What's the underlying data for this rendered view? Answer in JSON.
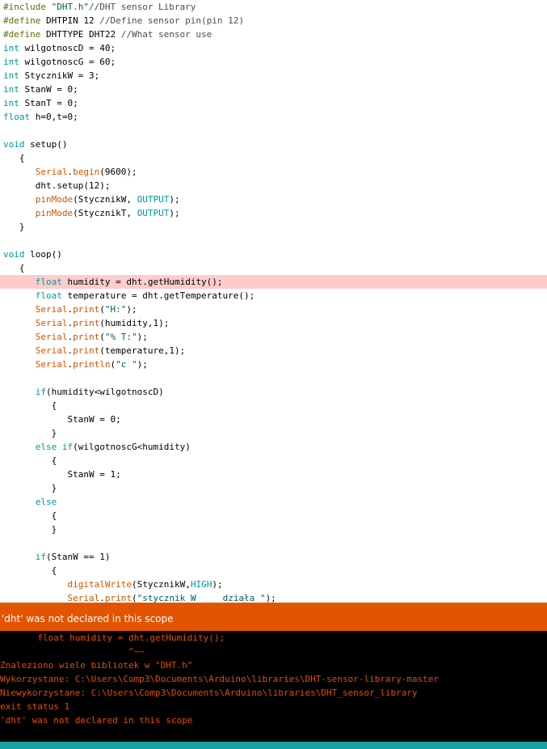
{
  "colors": {
    "keyword": "#00979c",
    "preprocessor": "#5e6d03",
    "string": "#005c5f",
    "comment": "#434f54",
    "function": "#d35400",
    "highlight": "#ffcccc",
    "status_bar": "#e35400",
    "console_text": "#e34c00",
    "bottom_strip": "#17a1a5"
  },
  "editor": {
    "highlighted_line": 20,
    "lines": [
      "#include \"DHT.h\"//DHT sensor Library",
      "#define DHTPIN 12 //Define sensor pin(pin 12)",
      "#define DHTTYPE DHT22 //What sensor use",
      "int wilgotnoscD = 40;",
      "int wilgotnoscG = 60;",
      "int StycznikW = 3;",
      "int StanW = 0;",
      "int StanT = 0;",
      "float h=0,t=0;",
      "",
      "void setup()",
      "   {",
      "      Serial.begin(9600);",
      "      dht.setup(12);",
      "      pinMode(StycznikW, OUTPUT);",
      "      pinMode(StycznikT, OUTPUT);",
      "   }",
      "",
      "void loop()",
      "   {",
      "      float humidity = dht.getHumidity();",
      "      float temperature = dht.getTemperature();",
      "      Serial.print(\"H:\");",
      "      Serial.print(humidity,1);",
      "      Serial.print(\"% T:\");",
      "      Serial.print(temperature,1);",
      "      Serial.println(\"c \");",
      "",
      "      if(humidity<wilgotnoscD)",
      "         {",
      "            StanW = 0;",
      "         }",
      "      else if(wilgotnoscG<humidity)",
      "         {",
      "            StanW = 1;",
      "         }",
      "      else",
      "         {",
      "         }",
      "",
      "      if(StanW == 1)",
      "         {",
      "            digitalWrite(StycznikW,HIGH);",
      "            Serial.print(\"stycznik W     działa \");"
    ]
  },
  "status_bar": {
    "message": "'dht' was not declared in this scope"
  },
  "console": {
    "lines": [
      "       float humidity = dht.getHumidity();",
      "                        ^~~",
      "Znaleziono wiele bibliotek w \"DHT.h\"",
      "Wykorzystane: C:\\Users\\Comp3\\Documents\\Arduino\\libraries\\DHT-sensor-library-master",
      "Niewykorzystane: C:\\Users\\Comp3\\Documents\\Arduino\\libraries\\DHT_sensor_library",
      "exit status 1",
      "'dht' was not declared in this scope"
    ]
  }
}
